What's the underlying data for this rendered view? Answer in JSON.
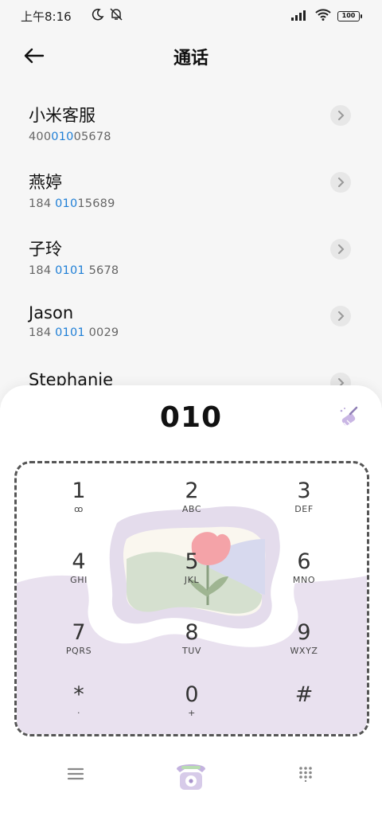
{
  "status_bar": {
    "time": "上午8:16",
    "battery": "100",
    "icons": [
      "moon-icon",
      "bell-off-icon",
      "signal-icon",
      "wifi-icon",
      "battery-icon"
    ]
  },
  "header": {
    "title": "通话",
    "back_icon": "arrow-left-icon"
  },
  "contacts": [
    {
      "name": "小米客服",
      "num_pre": "400",
      "num_hl": "010",
      "num_post": "05678"
    },
    {
      "name": "燕婷",
      "num_pre": "184 ",
      "num_hl": "010",
      "num_post": "15689"
    },
    {
      "name": "子玲",
      "num_pre": "184 ",
      "num_hl": "0101",
      "num_post": " 5678"
    },
    {
      "name": "Jason",
      "num_pre": "184 ",
      "num_hl": "0101",
      "num_post": " 0029"
    },
    {
      "name": "Stephanie",
      "num_pre": "",
      "num_hl": "",
      "num_post": ""
    }
  ],
  "dialer": {
    "number": "010",
    "keys": [
      {
        "digit": "1",
        "letters": "ꝏ"
      },
      {
        "digit": "2",
        "letters": "ABC"
      },
      {
        "digit": "3",
        "letters": "DEF"
      },
      {
        "digit": "4",
        "letters": "GHI"
      },
      {
        "digit": "5",
        "letters": "JKL"
      },
      {
        "digit": "6",
        "letters": "MNO"
      },
      {
        "digit": "7",
        "letters": "PQRS"
      },
      {
        "digit": "8",
        "letters": "TUV"
      },
      {
        "digit": "9",
        "letters": "WXYZ"
      },
      {
        "digit": "*",
        "letters": "·"
      },
      {
        "digit": "0",
        "letters": "+"
      },
      {
        "digit": "#",
        "letters": ""
      }
    ]
  },
  "bottom_nav": {
    "icons": [
      "menu-icon",
      "phone-call-icon",
      "keypad-icon"
    ]
  },
  "colors": {
    "highlight": "#1f7fd6",
    "panel_lavender": "#e9e1ef",
    "tulip": "#f4a3a8"
  }
}
